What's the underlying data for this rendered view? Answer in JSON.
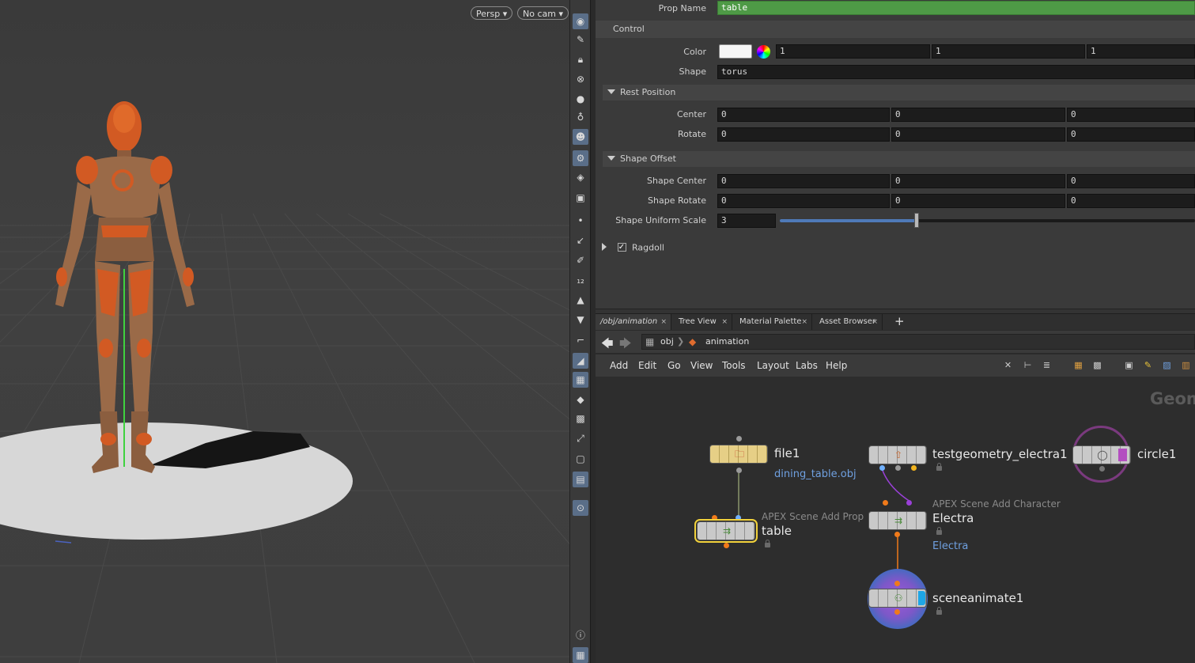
{
  "viewport": {
    "camera_mode": "Persp",
    "camera_name": "No cam"
  },
  "shelf": {
    "icons": [
      "eye-icon",
      "select-icon",
      "lock-icon",
      "ghost-icon",
      "sphere-shading-icon",
      "light-icon",
      "skeleton-icon",
      "camera-icon",
      "view-icon",
      "snapshot-icon",
      "point-icon",
      "brush-icon",
      "pen-icon",
      "number-12-icon",
      "flag-icon",
      "flag-12-icon",
      "corner-icon",
      "knife-icon",
      "checker-icon",
      "diamond-icon",
      "display-icon",
      "cursor-icon",
      "square-icon",
      "image-icon",
      "pin-icon",
      "info-icon",
      "grid-icon"
    ]
  },
  "params": {
    "prop_name_label": "Prop Name",
    "prop_name_value": "table",
    "control_header": "Control",
    "color_label": "Color",
    "color_values": [
      "1",
      "1",
      "1"
    ],
    "shape_label": "Shape",
    "shape_value": "torus",
    "rest_position_header": "Rest Position",
    "center_label": "Center",
    "center_values": [
      "0",
      "0",
      "0"
    ],
    "rotate_label": "Rotate",
    "rotate_values": [
      "0",
      "0",
      "0"
    ],
    "shape_offset_header": "Shape Offset",
    "shape_center_label": "Shape Center",
    "shape_center_values": [
      "0",
      "0",
      "0"
    ],
    "shape_rotate_label": "Shape Rotate",
    "shape_rotate_values": [
      "0",
      "0",
      "0"
    ],
    "uniform_scale_label": "Shape Uniform Scale",
    "uniform_scale_value": "3",
    "ragdoll_label": "Ragdoll"
  },
  "network": {
    "tabs": [
      {
        "label": "/obj/animation",
        "close": "×"
      },
      {
        "label": "Tree View",
        "close": "×"
      },
      {
        "label": "Material Palette",
        "close": "×"
      },
      {
        "label": "Asset Browser",
        "close": "×"
      }
    ],
    "add_tab": "+",
    "path": [
      "obj",
      "animation"
    ],
    "menu": [
      "Add",
      "Edit",
      "Go",
      "View",
      "Tools",
      "Layout",
      "Labs",
      "Help"
    ],
    "context_watermark": "Geom",
    "nodes": {
      "file1": {
        "name": "file1",
        "link": "dining_table.obj"
      },
      "table": {
        "type_label": "APEX Scene Add Prop",
        "name": "table"
      },
      "testgeometry": {
        "name": "testgeometry_electra1"
      },
      "electra": {
        "type_label": "APEX Scene Add Character",
        "name": "Electra",
        "link": "Electra"
      },
      "circle1": {
        "name": "circle1"
      },
      "sceneanimate1": {
        "name": "sceneanimate1"
      }
    }
  },
  "colors": {
    "prop_name_field": "#4e9a46",
    "selected_node_outline": "#f2d23c",
    "active_shelf_button": "#5a6e88",
    "link_text": "#6fa0e0"
  }
}
